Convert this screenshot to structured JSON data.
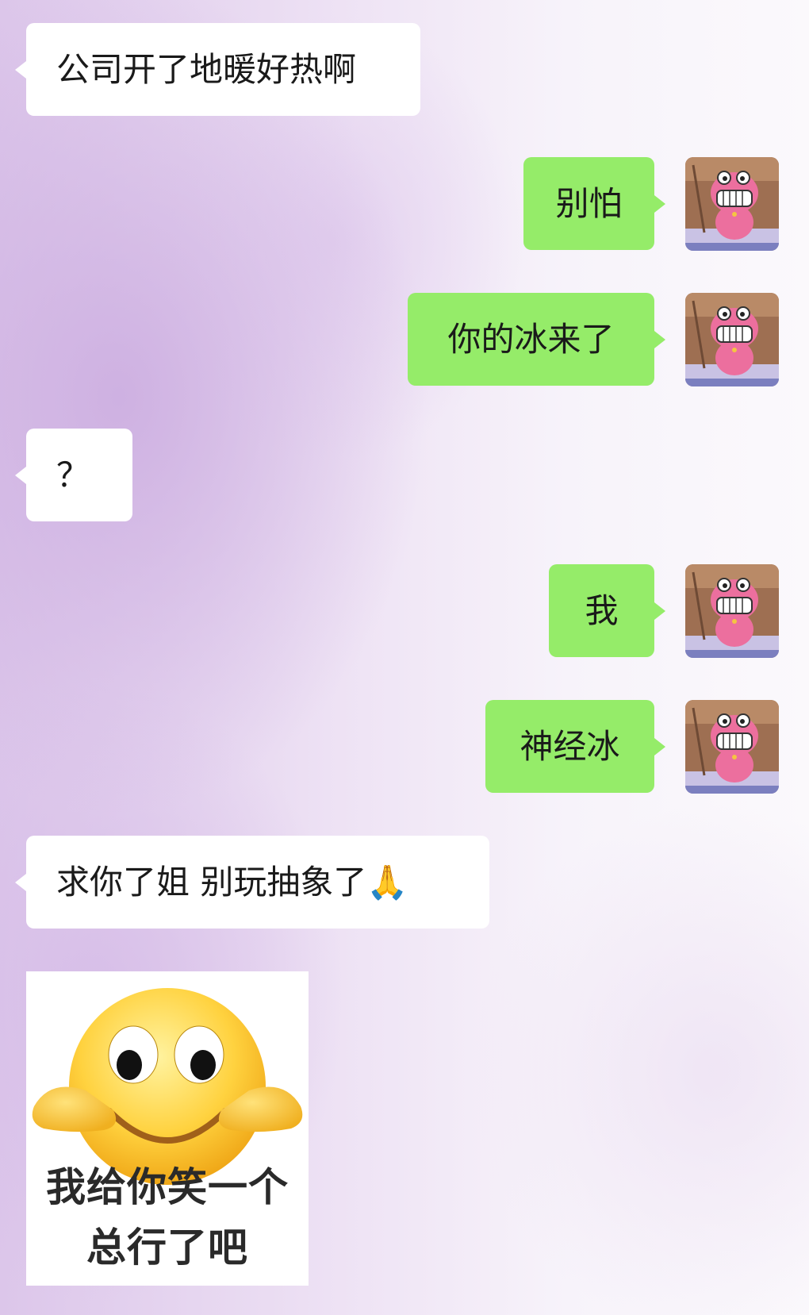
{
  "messages": [
    {
      "side": "in",
      "text": "公司开了地暖好热啊"
    },
    {
      "side": "out",
      "text": "别怕"
    },
    {
      "side": "out",
      "text": "你的冰来了"
    },
    {
      "side": "in",
      "text": "？"
    },
    {
      "side": "out",
      "text": "我"
    },
    {
      "side": "out",
      "text": "神经冰"
    },
    {
      "side": "in",
      "text": "求你了姐 别玩抽象了🙏"
    }
  ],
  "sticker": {
    "icon": "smiley-face-sticker",
    "caption_line1": "我给你笑一个",
    "caption_line2": "总行了吧"
  },
  "avatar": {
    "icon": "pink-crocodile-avatar"
  },
  "colors": {
    "outgoing_bubble": "#95ec69",
    "incoming_bubble": "#ffffff",
    "avatar_pink": "#ec6f9e",
    "avatar_bg": "#9e6f52"
  }
}
